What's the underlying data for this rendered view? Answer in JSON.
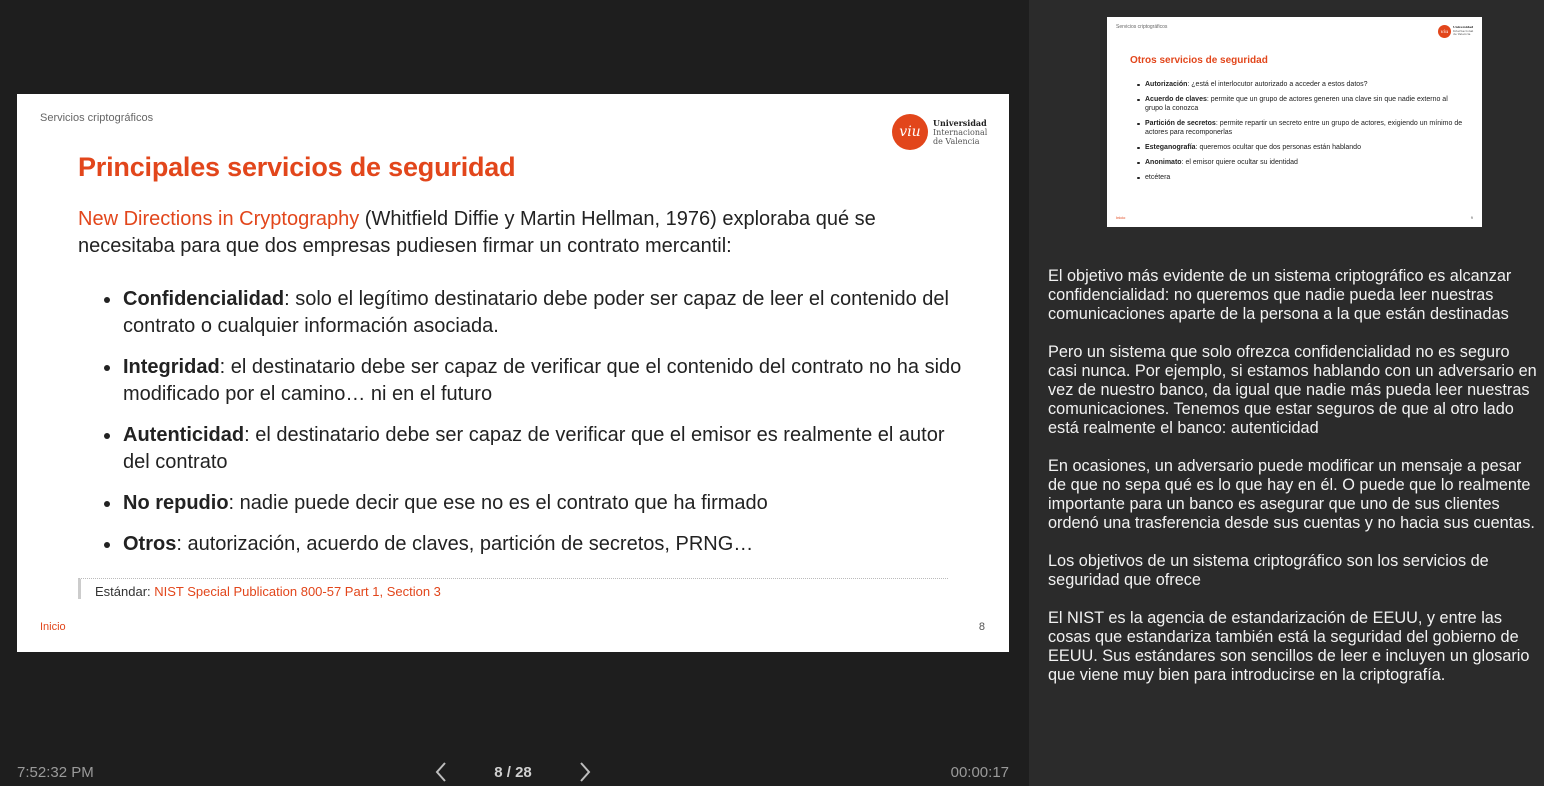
{
  "slide": {
    "header": "Servicios criptográficos",
    "logo": {
      "mark": "viu",
      "line1": "Universidad",
      "line2": "Internacional",
      "line3": "de Valencia"
    },
    "title": "Principales servicios de seguridad",
    "intro_link": "New Directions in Cryptography",
    "intro_rest": " (Whitfield Diffie y Martin Hellman, 1976) exploraba qué se necesitaba para que dos empresas pudiesen firmar un contrato mercantil:",
    "bullets": [
      {
        "term": "Confidencialidad",
        "text": ": solo el legítimo destinatario debe poder ser capaz de leer el contenido del contrato o cualquier información asociada."
      },
      {
        "term": "Integridad",
        "text": ": el destinatario debe ser capaz de verificar que el contenido del contrato no ha sido modificado por el camino… ni en el futuro"
      },
      {
        "term": "Autenticidad",
        "text": ": el destinatario debe ser capaz de verificar que el emisor es realmente el autor del contrato"
      },
      {
        "term": "No repudio",
        "text": ": nadie puede decir que ese no es el contrato que ha firmado"
      },
      {
        "term": "Otros",
        "text": ": autorización, acuerdo de claves, partición de secretos, PRNG…"
      }
    ],
    "standard_label": "Estándar: ",
    "standard_link": "NIST Special Publication 800-57 Part 1, Section 3",
    "footer_link": "Inicio",
    "page_number": "8"
  },
  "controls": {
    "clock": "7:52:32 PM",
    "counter": "8 / 28",
    "timer": "00:00:17",
    "prev_icon": "chevron-left-icon",
    "next_icon": "chevron-right-icon"
  },
  "next_slide": {
    "header": "Servicios criptográficos",
    "logo": {
      "mark": "viu",
      "line1": "Universidad",
      "line2": "Internacional",
      "line3": "de Valencia"
    },
    "title": "Otros servicios de seguridad",
    "bullets": [
      {
        "term": "Autorización",
        "text": ": ¿está el interlocutor autorizado a acceder a estos datos?"
      },
      {
        "term": "Acuerdo de claves",
        "text": ": permite que un grupo de actores generen una clave sin que nadie externo al grupo la conozca"
      },
      {
        "term": "Partición de secretos",
        "text": ": permite repartir un secreto entre un grupo de actores, exigiendo un mínimo de actores para recomponerlas"
      },
      {
        "term": "Esteganografía",
        "text": ": queremos ocultar que dos personas están hablando"
      },
      {
        "term": "Anonimato",
        "text": ": el emisor quiere ocultar su identidad"
      },
      {
        "term": "",
        "text": "etcétera"
      }
    ],
    "footer_link": "Inicio",
    "page_number": "9"
  },
  "notes": [
    "El objetivo más evidente de un sistema criptográfico es alcanzar confidencialidad: no queremos que nadie pueda leer nuestras comunicaciones aparte de la persona a la que están destinadas",
    "Pero un sistema que solo ofrezca confidencialidad no es seguro casi nunca. Por ejemplo, si estamos hablando con un adversario en vez de nuestro banco, da igual que nadie más pueda leer nuestras comunicaciones. Tenemos que estar seguros de que al otro lado está realmente el banco: autenticidad",
    "En ocasiones, un adversario puede modificar un mensaje a pesar de que no sepa qué es lo que hay en él. O puede que lo realmente importante para un banco es asegurar que uno de sus clientes ordenó una trasferencia desde sus cuentas y no hacia sus cuentas.",
    "Los objetivos de un sistema criptográfico son los servicios de seguridad que ofrece",
    "El NIST es la agencia de estandarización de EEUU, y entre las cosas que estandariza también está la seguridad del gobierno de EEUU. Sus estándares son sencillos de leer e incluyen un glosario que viene muy bien para introducirse en la criptografía."
  ],
  "colors": {
    "accent": "#e2461b",
    "background": "#1e1e1e",
    "notes_panel": "#2b2b2b"
  }
}
